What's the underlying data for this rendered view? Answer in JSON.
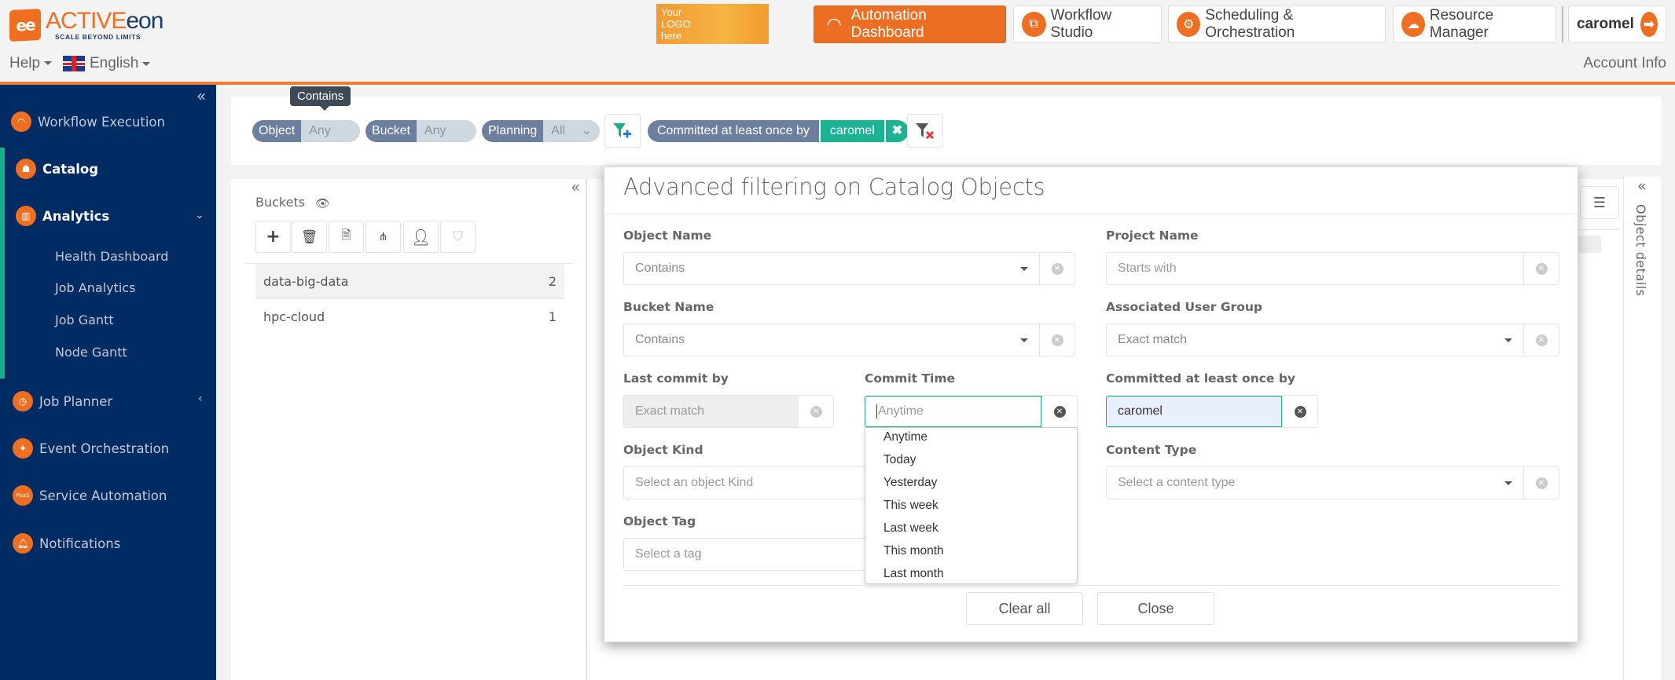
{
  "header": {
    "logo": {
      "brand_prefix": "ACTIVE",
      "brand_suffix": "eon",
      "tagline": "SCALE BEYOND LIMITS",
      "mark": "ee"
    },
    "help_label": "Help",
    "language_label": "English",
    "custom_logo_text": [
      "Your",
      "LOGO",
      "here"
    ],
    "nav_buttons": [
      {
        "label": "Automation Dashboard",
        "icon": "gauge-icon",
        "active": true
      },
      {
        "label": "Workflow Studio",
        "icon": "workflow-icon",
        "active": false
      },
      {
        "label": "Scheduling & Orchestration",
        "icon": "gears-icon",
        "active": false
      },
      {
        "label": "Resource Manager",
        "icon": "cloud-icon",
        "active": false
      }
    ],
    "user_label": "caromel",
    "account_info_label": "Account Info",
    "accent_color": "#ef7d34"
  },
  "sidebar": {
    "items": [
      {
        "label": "Workflow Execution",
        "icon": "gauge-icon"
      },
      {
        "label": "Catalog",
        "icon": "catalog-icon"
      },
      {
        "label": "Analytics",
        "icon": "analytics-icon"
      },
      {
        "label": "Job Planner",
        "icon": "clock-icon"
      },
      {
        "label": "Event Orchestration",
        "icon": "pulse-icon"
      },
      {
        "label": "Service Automation",
        "icon": "paas-icon"
      },
      {
        "label": "Notifications",
        "icon": "bell-icon"
      }
    ],
    "analytics_subitems": [
      "Health Dashboard",
      "Job Analytics",
      "Job Gantt",
      "Node Gantt"
    ],
    "bg_color": "#002b63",
    "active_accent": "#1aae8c"
  },
  "filter_bar": {
    "tooltip": "Contains",
    "pills": [
      {
        "key": "Object",
        "value": "Any"
      },
      {
        "key": "Bucket",
        "value": "Any"
      },
      {
        "key": "Planning",
        "value": "All"
      }
    ],
    "active_filter": {
      "key": "Committed at least once by",
      "value": "caromel"
    }
  },
  "buckets": {
    "title": "Buckets",
    "rows": [
      {
        "name": "data-big-data",
        "count": "2",
        "selected": true
      },
      {
        "name": "hpc-cloud",
        "count": "1",
        "selected": false
      }
    ]
  },
  "details_panel": {
    "label": "Object details"
  },
  "modal": {
    "title": "Advanced filtering on Catalog Objects",
    "fields": {
      "object_name": {
        "label": "Object Name",
        "value": "Contains"
      },
      "project_name": {
        "label": "Project Name",
        "placeholder": "Starts with"
      },
      "bucket_name": {
        "label": "Bucket Name",
        "value": "Contains"
      },
      "user_group": {
        "label": "Associated User Group",
        "value": "Exact match"
      },
      "last_commit_by": {
        "label": "Last commit by",
        "placeholder": "Exact match"
      },
      "commit_time": {
        "label": "Commit Time",
        "placeholder": "Anytime"
      },
      "committed_once_by": {
        "label": "Committed at least once by",
        "value": "caromel"
      },
      "object_kind": {
        "label": "Object Kind",
        "placeholder": "Select an object Kind"
      },
      "content_type": {
        "label": "Content Type",
        "placeholder": "Select a content type"
      },
      "object_tag": {
        "label": "Object Tag",
        "placeholder": "Select a tag"
      }
    },
    "commit_time_options": [
      "Anytime",
      "Today",
      "Yesterday",
      "This week",
      "Last week",
      "This month",
      "Last month"
    ],
    "clear_all_label": "Clear all",
    "close_label": "Close"
  }
}
